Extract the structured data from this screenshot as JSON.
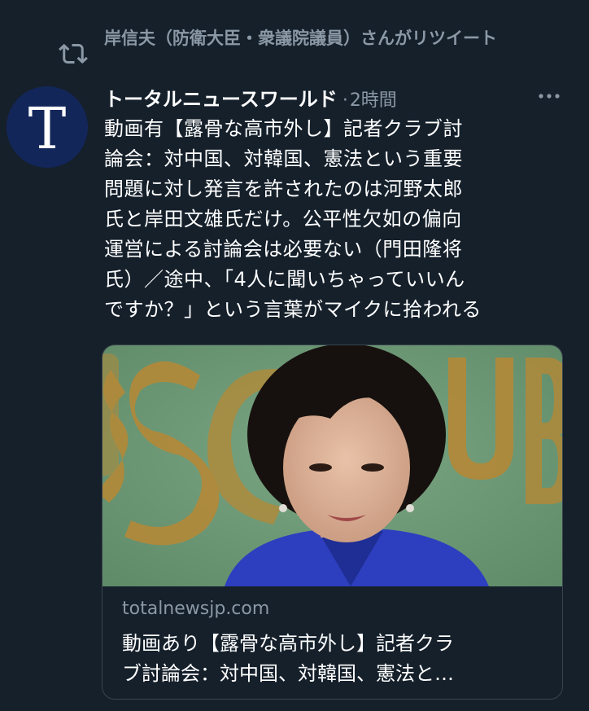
{
  "retweet": {
    "icon": "retweet-icon",
    "text": "岸信夫（防衛大臣・衆議院議員）さんがリツイート"
  },
  "tweet": {
    "avatar_letter": "T",
    "author_name": "トータルニュースワールド",
    "separator": "·",
    "time": "2時間",
    "body_lines": [
      "動画有【露骨な高市外し】記者クラブ討",
      "論会：対中国、対韓国、憲法という重要",
      "問題に対し発言を許されたのは河野太郎",
      "氏と岸田文雄氏だけ。公平性欠如の偏向",
      "運営による討論会は必要ない（門田隆将",
      "氏）／途中、「4人に聞いちゃっていいん",
      "ですか？」という言葉がマイクに拾われる"
    ]
  },
  "card": {
    "domain": "totalnewsjp.com",
    "title_lines": [
      "動画あり【露骨な高市外し】記者クラ",
      "ブ討論会：対中国、対韓国、憲法と…"
    ]
  },
  "icons": {
    "more": "more-icon",
    "retweet": "retweet-icon"
  },
  "colors": {
    "background": "#15202b",
    "secondary_text": "#8b98a5",
    "avatar_bg": "#13265a",
    "card_border": "#38444d",
    "photo_wall": "#6f9a78",
    "photo_lettering": "#b08a3a",
    "photo_jacket": "#2d3fbf"
  }
}
